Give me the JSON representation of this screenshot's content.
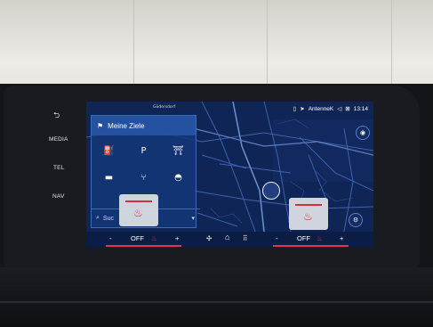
{
  "side_buttons": {
    "back_icon": "back-arrow-icon",
    "media": "MEDIA",
    "tel": "TEL",
    "nav": "NAV"
  },
  "status_bar": {
    "antenna_label": "AntenneK",
    "time": "13:14"
  },
  "map_labels": {
    "town": "Gödersdorf"
  },
  "destinations_panel": {
    "title": "Meine Ziele",
    "categories": [
      {
        "icon": "fuel-pump-icon",
        "glyph": "⛽"
      },
      {
        "icon": "parking-icon",
        "glyph": "P"
      },
      {
        "icon": "picnic-table-icon",
        "glyph": "⛩"
      },
      {
        "icon": "car-icon",
        "glyph": "▬"
      },
      {
        "icon": "restaurant-icon",
        "glyph": "⑂"
      },
      {
        "icon": "fast-food-icon",
        "glyph": "◓"
      }
    ],
    "search_placeholder": "Suc"
  },
  "climate_bar": {
    "left": {
      "minus": "-",
      "value": "OFF",
      "plus": "+"
    },
    "right": {
      "minus": "-",
      "value": "OFF",
      "plus": "+"
    },
    "accent_color": "#e8344a"
  },
  "colors": {
    "map_bg": "#0e2352",
    "panel_bg": "#1a3b7a"
  }
}
